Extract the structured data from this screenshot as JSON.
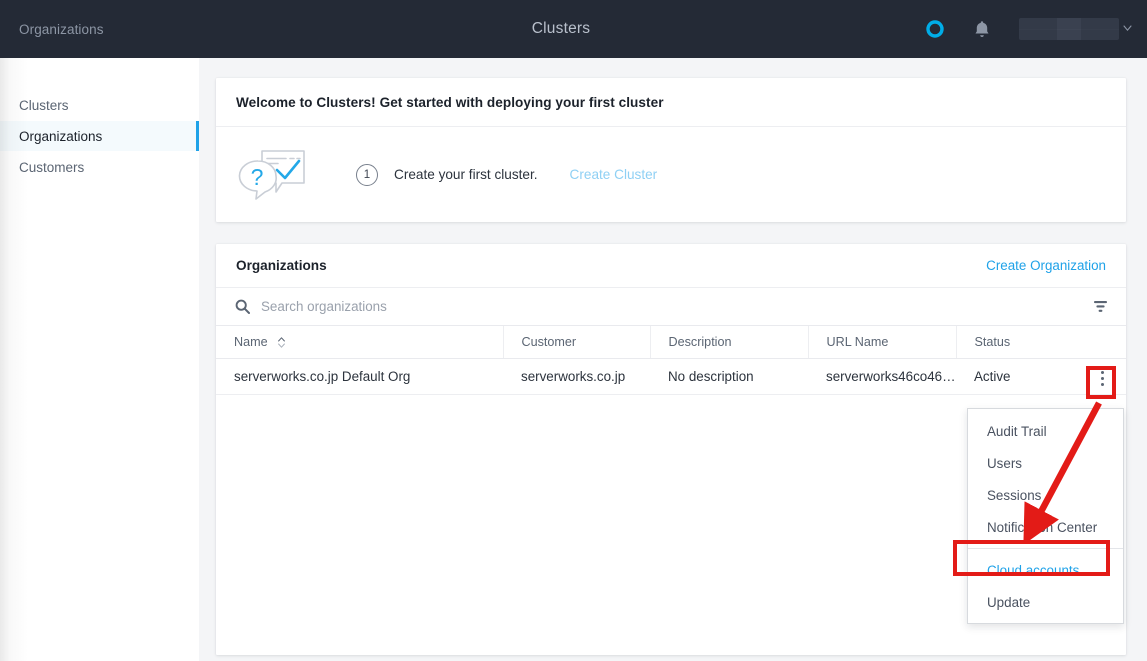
{
  "topbar": {
    "left_label": "Organizations",
    "brand_icon": "x-logo-icon",
    "brand_title": "Clusters",
    "status_icon": "circle-ring-icon",
    "notifications_icon": "bell-icon",
    "user_menu_caret": "chevron-down-icon",
    "accent_color": "#1fa2e8"
  },
  "sidebar": {
    "items": [
      {
        "label": "Clusters",
        "active": false
      },
      {
        "label": "Organizations",
        "active": true
      },
      {
        "label": "Customers",
        "active": false
      }
    ]
  },
  "welcome": {
    "title": "Welcome to Clusters! Get started with deploying your first cluster",
    "illustration_icon": "question-check-speech-bubbles-icon",
    "step_number": "1",
    "step_text": "Create your first cluster.",
    "step_link": "Create Cluster"
  },
  "organizations": {
    "title": "Organizations",
    "create_label": "Create Organization",
    "search": {
      "icon": "search-icon",
      "placeholder": "Search organizations",
      "value": ""
    },
    "filter_icon": "filter-funnel-icon",
    "columns": [
      "Name",
      "Customer",
      "Description",
      "URL Name",
      "Status"
    ],
    "sort_column": "Name",
    "sort_icon": "sort-updown-icon",
    "rows": [
      {
        "name": "serverworks.co.jp Default Org",
        "customer": "serverworks.co.jp",
        "description": "No description",
        "description_muted": true,
        "url_name": "serverworks46co46j...",
        "status": "Active",
        "menu_icon": "kebab-menu-icon"
      }
    ]
  },
  "row_menu": {
    "items": [
      {
        "label": "Audit Trail",
        "highlighted": false
      },
      {
        "label": "Users",
        "highlighted": false
      },
      {
        "label": "Sessions",
        "highlighted": false
      },
      {
        "label": "Notification Center",
        "highlighted": false
      },
      {
        "label": "Cloud accounts",
        "highlighted": true
      },
      {
        "label": "Update",
        "highlighted": false
      }
    ]
  },
  "annotations": {
    "highlight_color": "#e31b17",
    "kebab_highlight_target": "kebab-menu-icon",
    "menu_highlight_target": "Cloud accounts",
    "arrow_icon": "red-arrow-icon"
  }
}
